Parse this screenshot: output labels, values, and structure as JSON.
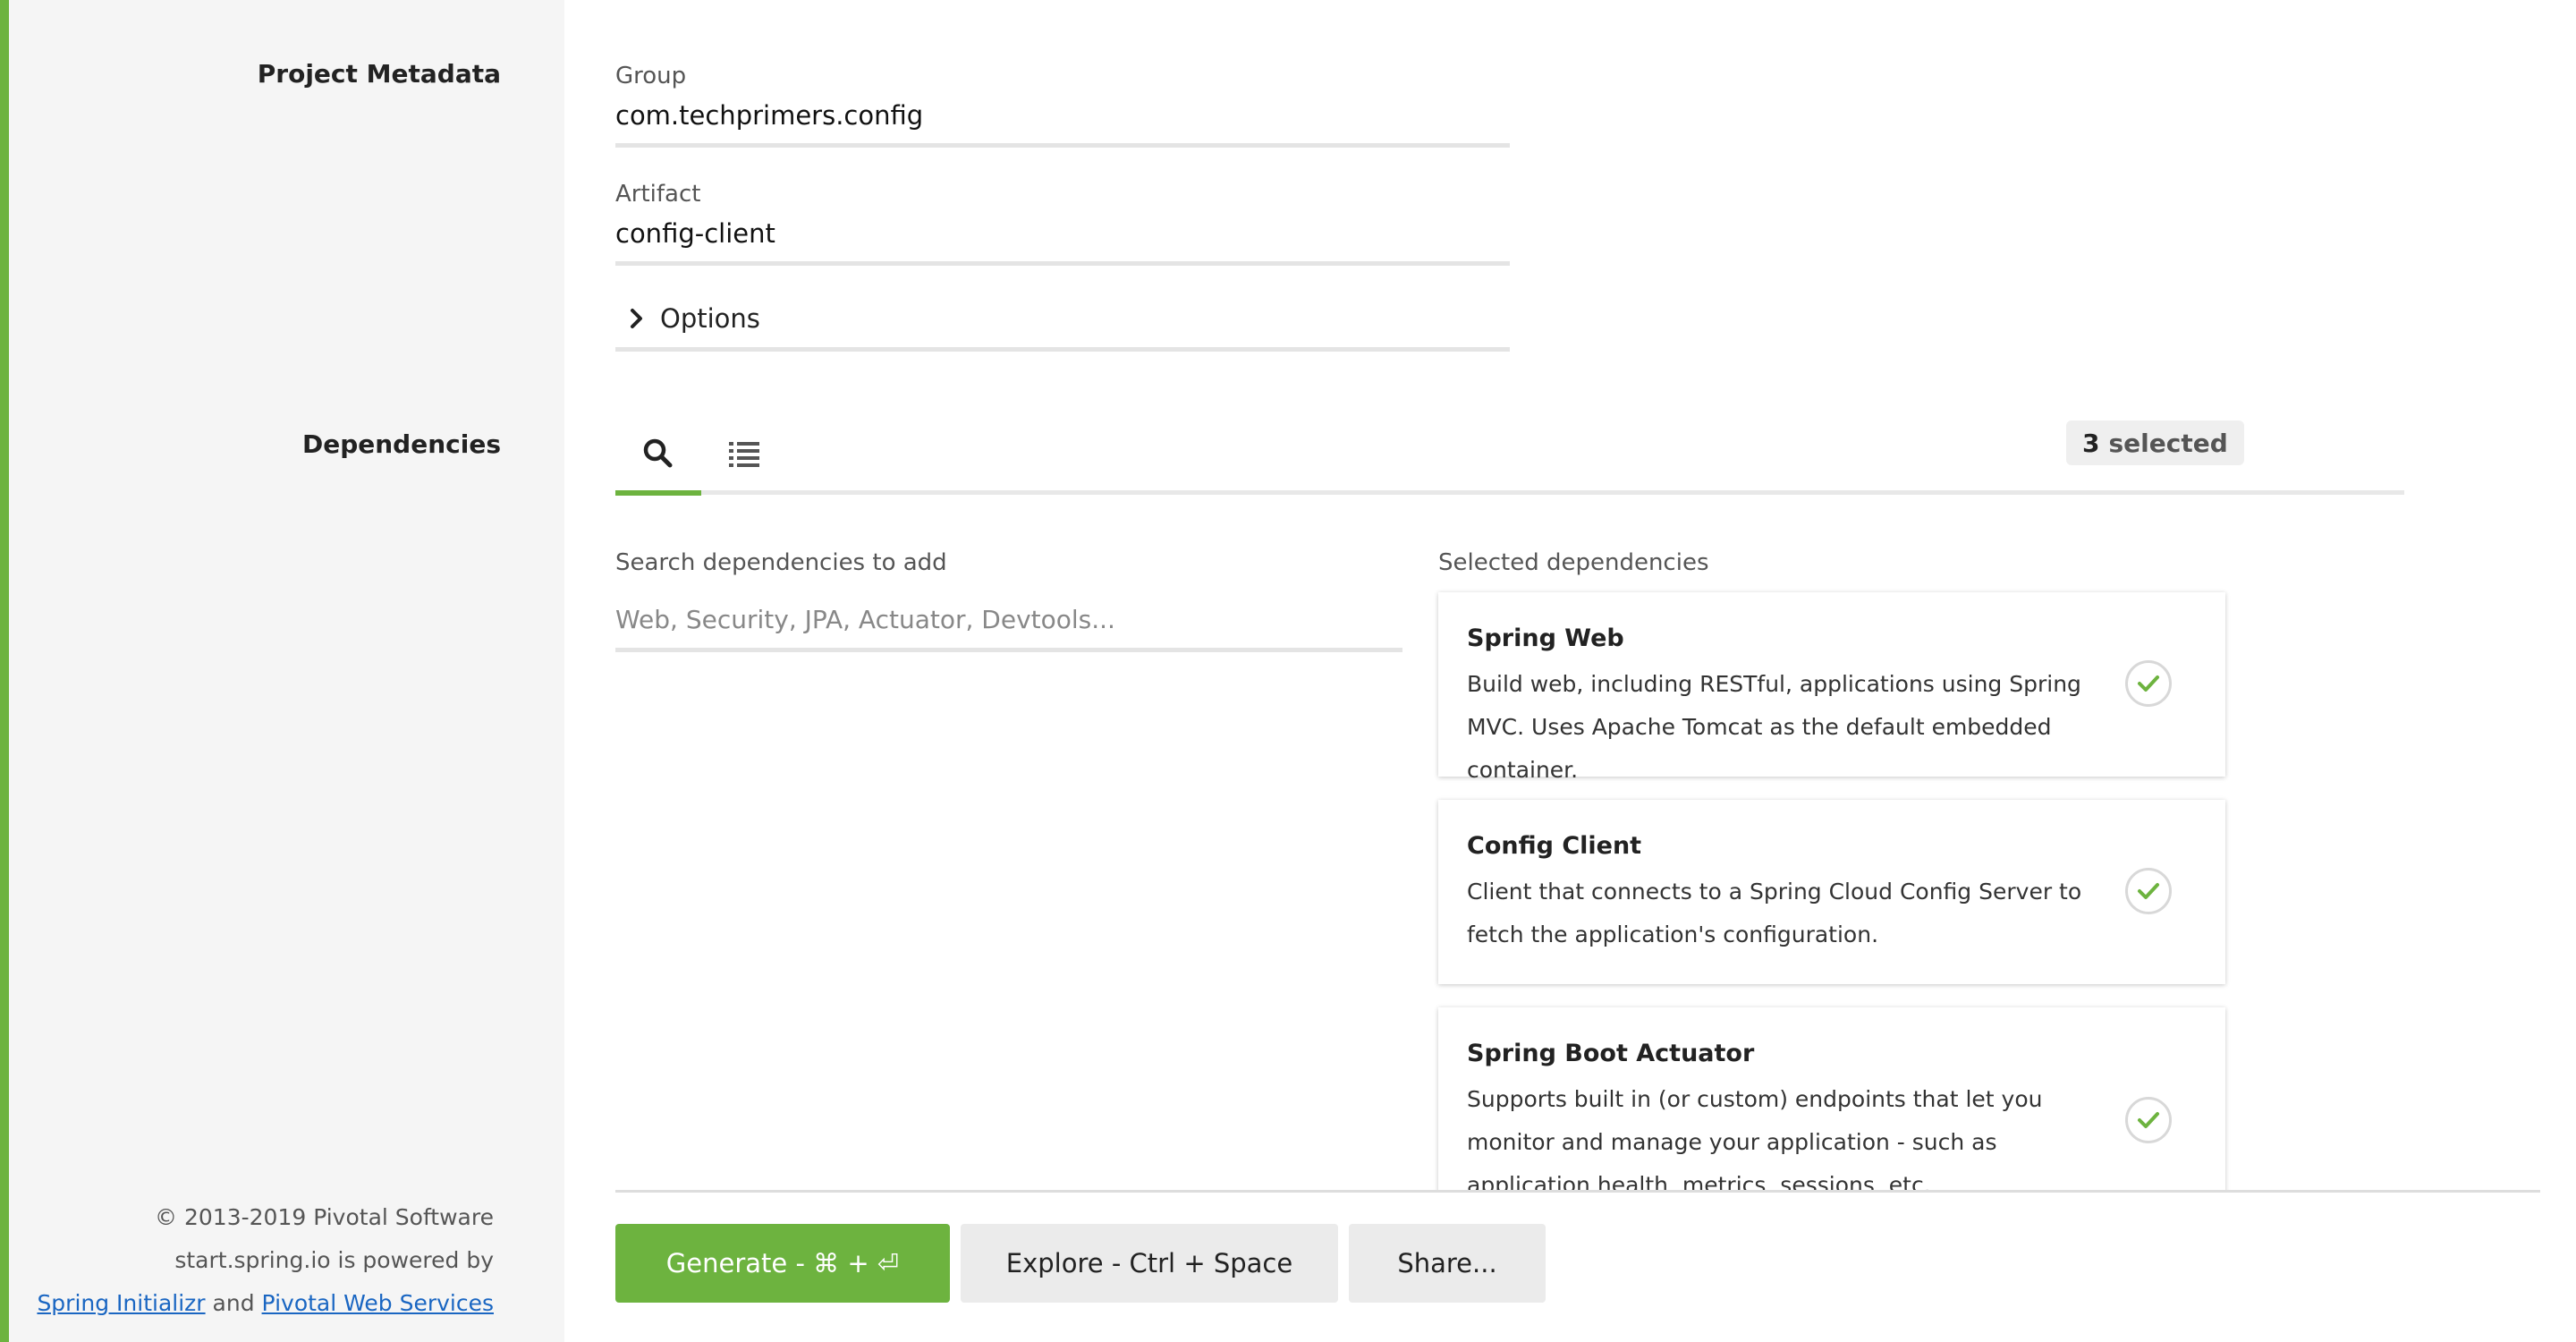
{
  "metadata": {
    "section_title": "Project Metadata",
    "group_label": "Group",
    "group_value": "com.techprimers.config",
    "artifact_label": "Artifact",
    "artifact_value": "config-client",
    "options_label": "Options"
  },
  "dependencies": {
    "section_title": "Dependencies",
    "tabs": [
      {
        "name": "search",
        "icon": "search-icon",
        "active": true
      },
      {
        "name": "list",
        "icon": "list-icon",
        "active": false
      }
    ],
    "selected_count": "3",
    "selected_suffix": "selected",
    "search_label": "Search dependencies to add",
    "search_placeholder": "Web, Security, JPA, Actuator, Devtools...",
    "selected_label": "Selected dependencies",
    "items": [
      {
        "title": "Spring Web",
        "description": "Build web, including RESTful, applications using Spring MVC. Uses Apache Tomcat as the default embedded container."
      },
      {
        "title": "Config Client",
        "description": "Client that connects to a Spring Cloud Config Server to fetch the application's configuration."
      },
      {
        "title": "Spring Boot Actuator",
        "description": "Supports built in (or custom) endpoints that let you monitor and manage your application - such as application health, metrics, sessions, etc."
      }
    ]
  },
  "footer": {
    "copyright": "© 2013-2019 Pivotal Software",
    "powered_by": "start.spring.io is powered by",
    "link_initializr": "Spring Initializr",
    "and_text": "and",
    "link_pws": "Pivotal Web Services"
  },
  "actions": {
    "generate": "Generate - ⌘ + ⏎",
    "explore": "Explore - Ctrl + Space",
    "share": "Share..."
  },
  "colors": {
    "accent": "#6db33f",
    "sidebar_bg": "#f5f5f5",
    "link": "#1a66c2"
  }
}
